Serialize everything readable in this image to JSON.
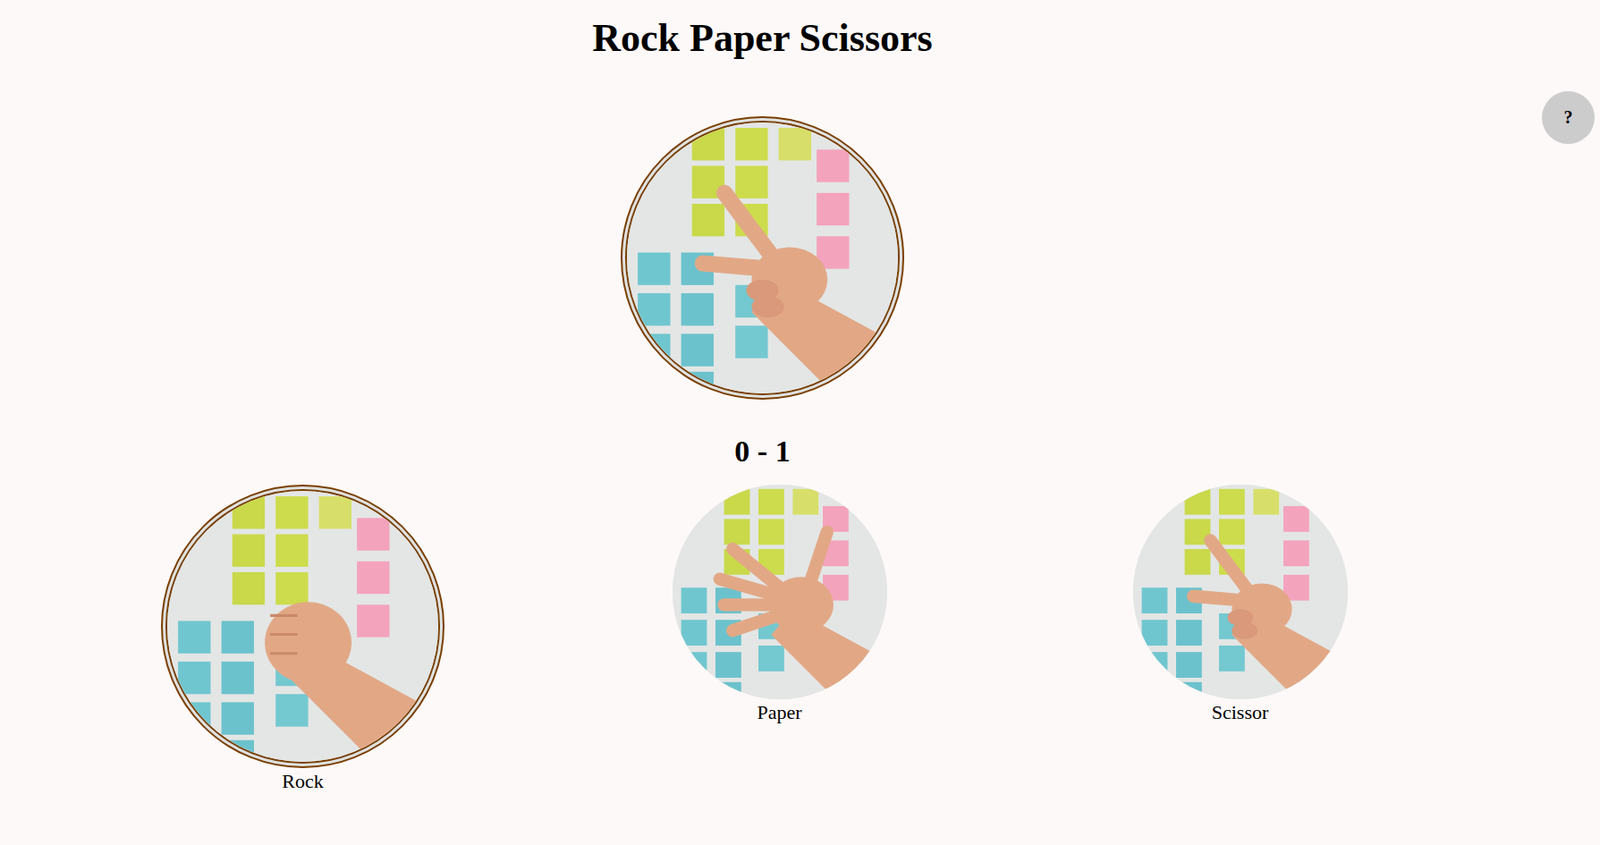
{
  "title": "Rock Paper Scissors",
  "help_button": "?",
  "computer_choice": {
    "kind": "scissor"
  },
  "score": "0 - 1",
  "options": [
    {
      "label": "Rock",
      "kind": "rock",
      "selected": true
    },
    {
      "label": "Paper",
      "kind": "paper",
      "selected": false
    },
    {
      "label": "Scissor",
      "kind": "scissor",
      "selected": false
    }
  ]
}
